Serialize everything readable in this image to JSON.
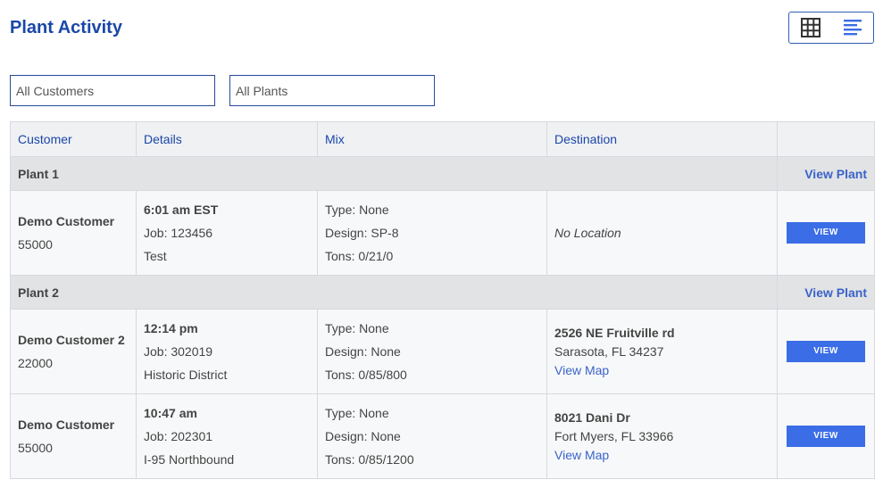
{
  "header": {
    "title": "Plant Activity"
  },
  "toggle": {
    "grid_icon": "grid-icon",
    "list_icon": "list-icon"
  },
  "filters": {
    "customers": "All Customers",
    "plants": "All Plants"
  },
  "table": {
    "columns": [
      "Customer",
      "Details",
      "Mix",
      "Destination",
      ""
    ],
    "groups": [
      {
        "plant": "Plant 1",
        "view_plant": "View Plant",
        "rows": [
          {
            "customer": "Demo Customer",
            "number": "55000",
            "time": "6:01 am EST",
            "job": "Job: 123456",
            "note": "Test",
            "type": "Type: None",
            "design": "Design: SP-8",
            "tons": "Tons: 0/21/0",
            "destination": "No Location",
            "button": "VIEW"
          }
        ]
      },
      {
        "plant": "Plant 2",
        "view_plant": "View Plant",
        "rows": [
          {
            "customer": "Demo Customer 2",
            "number": "22000",
            "time": "12:14 pm",
            "job": "Job: 302019",
            "note": "Historic District",
            "type": "Type: None",
            "design": "Design: None",
            "tons": "Tons: 0/85/800",
            "address": "2526 NE Fruitville rd",
            "city": "Sarasota, FL 34237",
            "map": "View Map",
            "button": "VIEW"
          },
          {
            "customer": "Demo Customer",
            "number": "55000",
            "time": "10:47 am",
            "job": "Job: 202301",
            "note": "I-95 Northbound",
            "type": "Type: None",
            "design": "Design: None",
            "tons": "Tons: 0/85/1200",
            "address": "8021 Dani Dr",
            "city": "Fort Myers, FL 33966",
            "map": "View Map",
            "button": "VIEW"
          }
        ]
      }
    ]
  }
}
